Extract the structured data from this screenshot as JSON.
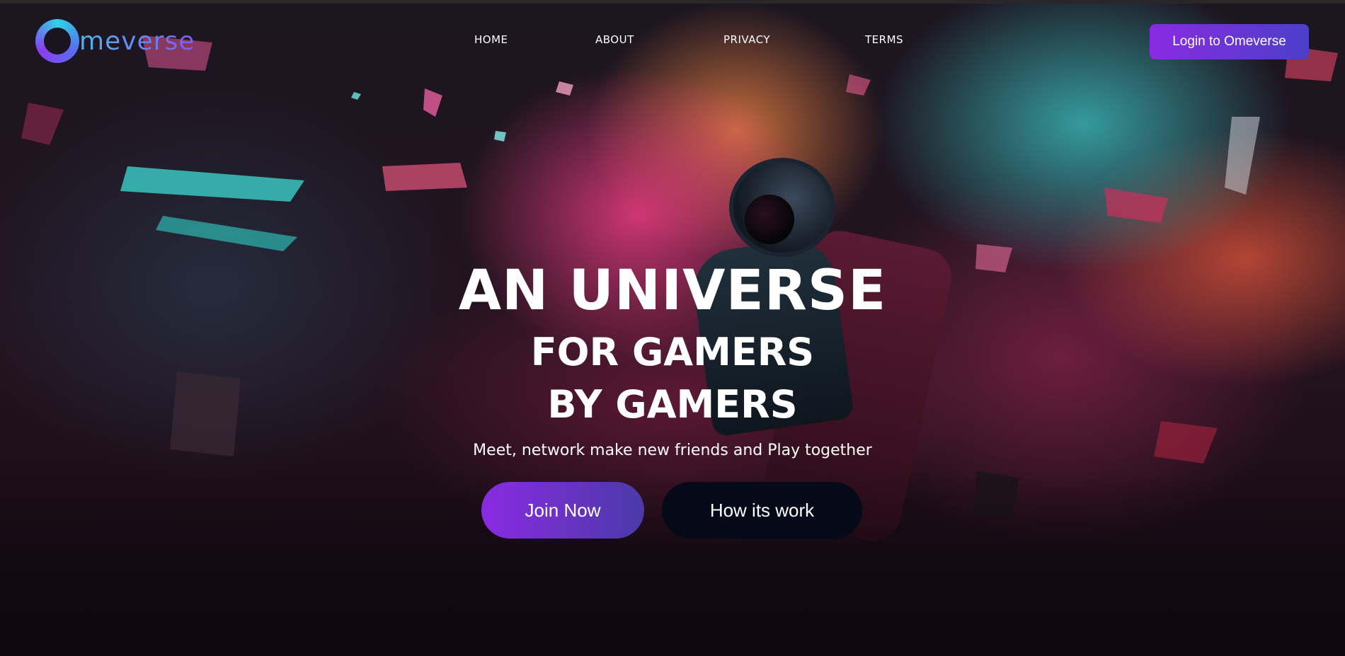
{
  "brand": {
    "logo_text": "meverse",
    "logo_icon": "o-ring-logo-icon"
  },
  "nav": {
    "items": [
      {
        "label": "HOME"
      },
      {
        "label": "ABOUT"
      },
      {
        "label": "PRIVACY"
      },
      {
        "label": "TERMS"
      }
    ],
    "login_label": "Login to Omeverse"
  },
  "hero": {
    "headline_line1": "AN UNIVERSE",
    "headline_line2": "FOR GAMERS",
    "headline_line3": "BY GAMERS",
    "subtitle": "Meet, network make new friends and Play together",
    "primary_cta": "Join Now",
    "secondary_cta": "How its work"
  },
  "colors": {
    "accent_purple": "#8a2be2",
    "accent_indigo": "#4b3fc8",
    "logo_cyan": "#2fd1e6",
    "dark_button": "#050a18"
  }
}
